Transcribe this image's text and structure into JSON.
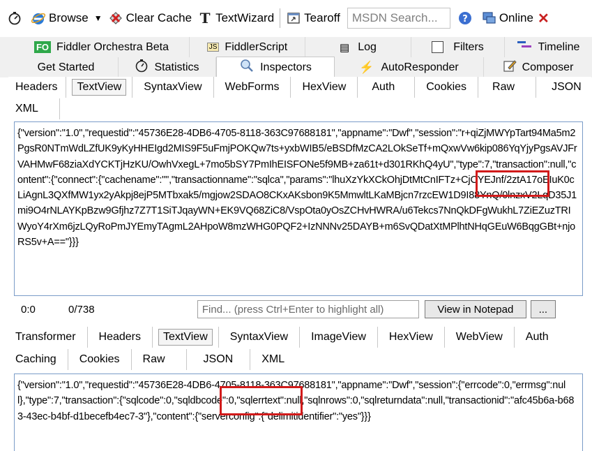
{
  "toolbar": {
    "browse": "Browse",
    "clear_cache": "Clear Cache",
    "textwizard": "TextWizard",
    "tearoff": "Tearoff",
    "search_placeholder": "MSDN Search...",
    "online": "Online"
  },
  "main_tabs_row1": [
    "Fiddler Orchestra Beta",
    "FiddlerScript",
    "Log",
    "Filters",
    "Timeline"
  ],
  "main_tabs_row2": [
    "Get Started",
    "Statistics",
    "Inspectors",
    "AutoResponder",
    "Composer"
  ],
  "request_tabs_row1": [
    "Headers",
    "TextView",
    "SyntaxView",
    "WebForms",
    "HexView",
    "Auth",
    "Cookies",
    "Raw",
    "JSON"
  ],
  "request_tabs_row2": [
    "XML"
  ],
  "request_body": "{\"version\":\"1.0\",\"requestid\":\"45736E28-4DB6-4705-8118-363C97688181\",\"appname\":\"Dwf\",\"session\":\"r+qiZjMWYpTart94Ma5m2PgsR0NTmWdLZfUK9yKyHHEIgd2MIS9F5uFmjPOKQw7ts+yxbWIB5/eBSDfMzCA2LOkSeTf+mQxwVw6kip086YqYjyPgsAVJFrVAHMwF68ziaXdYCKTjHzKU/OwhVxegL+7mo5bSY7PmIhEISFONe5f9MB+za61t+d301RKhQ4yU\",\"type\":7,\"transaction\":null,\"content\":{\"connect\":{\"cachename\":\"\",\"transactionname\":\"sqlca\",\"params\":\"lhuXzYkXCkOhjDtMtCnIFTz+CjCYEJnf/2ztA17oEIuK0cLiAgnL3QXfMW1yx2yAkpj8ejP5MTbxak5/mgjow2SDAO8CKxAKsbon9K5MmwltLKaMBjcn7rzcEW1D9I88YnQ/0lnzxV2LqD35J1mi9O4rNLAYKpBzw9Gfjhz7Z7T1SiTJqayWN+EK9VQ68ZiC8/VspOta0yOsZCHvHWRA/u6Tekcs7NnQkDFgWukhL7ZiEZuzTRIWyoY4rXm6jzLQyRoPmJYEmyTAgmL2AHpoW8mzWHG0PQF2+IzNNNv25DAYB+m6SvQDatXtMPlhtNHqGEuW6BqgGBt+njoRS5v+A==\"}}}",
  "status": {
    "position": "0:0",
    "count": "0/738",
    "find_placeholder": "Find... (press Ctrl+Enter to highlight all)",
    "view_notepad": "View in Notepad",
    "more": "..."
  },
  "response_tabs_row1": [
    "Transformer",
    "Headers",
    "TextView",
    "SyntaxView",
    "ImageView",
    "HexView",
    "WebView",
    "Auth"
  ],
  "response_tabs_row2": [
    "Caching",
    "Cookies",
    "Raw",
    "JSON",
    "XML"
  ],
  "response_body": "{\"version\":\"1.0\",\"requestid\":\"45736E28-4DB6-4705-8118-363C97688181\",\"appname\":\"Dwf\",\"session\":{\"errcode\":0,\"errmsg\":null},\"type\":7,\"transaction\":{\"sqlcode\":0,\"sqldbcode\":0,\"sqlerrtext\":null,\"sqlnrows\":0,\"sqlreturndata\":null,\"transactionid\":\"afc45b6a-b683-43ec-b4bf-d1becefb4ec7-3\"},\"content\":{\"serverconfig\":{\"delimitidentifier\":\"yes\"}}}"
}
